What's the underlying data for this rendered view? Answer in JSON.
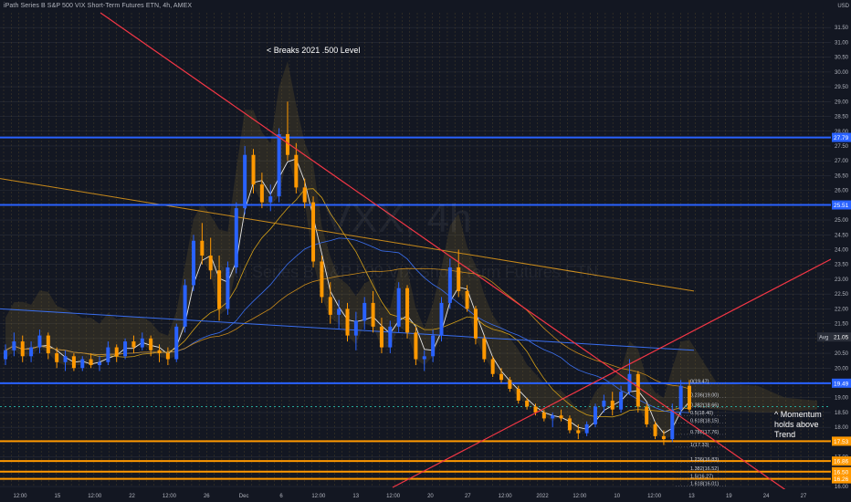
{
  "header": {
    "title": "iPath Series B S&P 500 VIX Short-Term Futures ETN, 4h, AMEX",
    "currency": "USD"
  },
  "watermark": {
    "symbol": "VXX, 4h",
    "name": "iPath Series B S&P 500 VIX Short-Term Futures ETN"
  },
  "annotations": {
    "breaks": "< Breaks 2021 .500 Level",
    "momentum": "^  Momentum\n    holds above\n    Trend"
  },
  "colors": {
    "background": "#131722",
    "grid": "#2a2e39",
    "vertical_grid": "#6b5a2e",
    "level_blue": "#2962ff",
    "level_orange": "#ff9800",
    "trend_red": "#f23645",
    "candle_up": "#2962ff",
    "candle_down": "#ff9800",
    "cloud": "#3a3a2a"
  },
  "chart_data": {
    "type": "candlestick",
    "title": "iPath Series B S&P 500 VIX Short-Term Futures ETN, 4h, AMEX",
    "y_axis": {
      "min": 16.0,
      "max": 32.0,
      "ticks": [
        "31.50",
        "31.00",
        "30.50",
        "30.00",
        "29.50",
        "29.00",
        "28.50",
        "28.00",
        "27.50",
        "27.00",
        "26.50",
        "26.00",
        "25.50",
        "25.00",
        "24.50",
        "24.00",
        "23.50",
        "23.00",
        "22.50",
        "22.00",
        "21.50",
        "21.00",
        "20.50",
        "20.00",
        "19.50",
        "19.00",
        "18.50",
        "18.00",
        "17.50",
        "17.00",
        "16.50",
        "16.00"
      ]
    },
    "x_axis": {
      "ticks": [
        "12:00",
        "15",
        "12:00",
        "22",
        "12:00",
        "26",
        "Dec",
        "6",
        "12:00",
        "13",
        "12:00",
        "20",
        "27",
        "12:00",
        "2022",
        "12:00",
        "10",
        "12:00",
        "13",
        "19",
        "24",
        "27"
      ]
    },
    "price_labels": [
      {
        "value": 27.79,
        "label": "27.79",
        "color": "#2962ff"
      },
      {
        "value": 25.51,
        "label": "25.51",
        "color": "#2962ff"
      },
      {
        "value": 21.05,
        "label": "21.05",
        "tag": "Avg",
        "color": "#2a2e39"
      },
      {
        "value": 19.49,
        "label": "19.49",
        "color": "#2962ff"
      },
      {
        "value": 17.53,
        "label": "17.53",
        "color": "#ff9800"
      },
      {
        "value": 16.86,
        "label": "16.86",
        "color": "#ff9800"
      },
      {
        "value": 16.5,
        "label": "16.50",
        "color": "#ff9800"
      },
      {
        "value": 16.26,
        "label": "16.26",
        "color": "#ff9800"
      }
    ],
    "horizontal_levels": [
      {
        "value": 27.79,
        "color": "blue"
      },
      {
        "value": 25.51,
        "color": "blue"
      },
      {
        "value": 19.49,
        "color": "blue"
      },
      {
        "value": 18.7,
        "color": "teal-dotted"
      },
      {
        "value": 17.53,
        "color": "orange"
      },
      {
        "value": 16.86,
        "color": "orange"
      },
      {
        "value": 16.5,
        "color": "orange"
      },
      {
        "value": 16.26,
        "color": "orange"
      }
    ],
    "fib_labels": [
      {
        "label": "0(19.47)",
        "value": 19.47
      },
      {
        "label": "0.236(19.00)",
        "value": 19.0
      },
      {
        "label": "0.382(18.66)",
        "value": 18.66
      },
      {
        "label": "0.5(18.40)",
        "value": 18.4
      },
      {
        "label": "0.618(18.15)",
        "value": 18.15
      },
      {
        "label": "0.786(17.76)",
        "value": 17.76
      },
      {
        "label": "1(17.33)",
        "value": 17.33
      },
      {
        "label": "1.236(16.83)",
        "value": 16.83
      },
      {
        "label": "1.382(16.52)",
        "value": 16.52
      },
      {
        "label": "1.5(16.27)",
        "value": 16.27
      },
      {
        "label": "1.618(16.01)",
        "value": 16.01
      }
    ],
    "candles": [
      [
        20.3,
        20.8,
        20.1,
        20.6
      ],
      [
        20.6,
        21.2,
        20.4,
        20.9
      ],
      [
        20.9,
        21.1,
        20.2,
        20.4
      ],
      [
        20.4,
        20.9,
        20.2,
        20.7
      ],
      [
        20.7,
        21.3,
        20.5,
        21.1
      ],
      [
        21.1,
        21.2,
        20.3,
        20.5
      ],
      [
        20.5,
        20.7,
        20.0,
        20.2
      ],
      [
        20.2,
        20.6,
        19.9,
        20.4
      ],
      [
        20.4,
        20.5,
        19.9,
        20.0
      ],
      [
        20.0,
        20.4,
        19.9,
        20.3
      ],
      [
        20.3,
        20.5,
        20.0,
        20.1
      ],
      [
        20.1,
        20.4,
        19.9,
        20.2
      ],
      [
        20.2,
        20.9,
        20.1,
        20.7
      ],
      [
        20.7,
        20.8,
        20.2,
        20.4
      ],
      [
        20.4,
        21.0,
        20.3,
        20.9
      ],
      [
        20.9,
        21.1,
        20.5,
        20.7
      ],
      [
        20.7,
        21.2,
        20.6,
        21.0
      ],
      [
        21.0,
        21.1,
        20.4,
        20.6
      ],
      [
        20.6,
        20.8,
        20.2,
        20.5
      ],
      [
        20.5,
        20.7,
        20.1,
        20.3
      ],
      [
        20.3,
        21.5,
        20.2,
        21.4
      ],
      [
        21.4,
        23.0,
        21.2,
        22.8
      ],
      [
        22.8,
        24.5,
        22.6,
        24.3
      ],
      [
        24.3,
        24.9,
        23.5,
        23.8
      ],
      [
        23.8,
        24.4,
        23.0,
        23.3
      ],
      [
        23.3,
        23.8,
        21.6,
        22.0
      ],
      [
        22.0,
        23.6,
        21.8,
        23.4
      ],
      [
        23.4,
        25.6,
        23.2,
        25.4
      ],
      [
        25.4,
        27.5,
        25.2,
        27.2
      ],
      [
        27.2,
        27.4,
        25.9,
        26.2
      ],
      [
        26.2,
        26.6,
        25.4,
        25.6
      ],
      [
        25.6,
        26.2,
        25.3,
        25.8
      ],
      [
        25.8,
        28.1,
        25.6,
        27.9
      ],
      [
        27.9,
        29.0,
        27.0,
        27.2
      ],
      [
        27.2,
        27.6,
        25.9,
        26.1
      ],
      [
        26.1,
        26.4,
        25.4,
        25.6
      ],
      [
        25.6,
        25.8,
        23.4,
        23.6
      ],
      [
        23.6,
        23.8,
        22.2,
        22.4
      ],
      [
        22.4,
        22.9,
        21.5,
        21.8
      ],
      [
        21.8,
        22.3,
        21.3,
        22.0
      ],
      [
        22.0,
        22.2,
        20.9,
        21.1
      ],
      [
        21.1,
        21.9,
        20.6,
        21.6
      ],
      [
        21.6,
        22.4,
        21.3,
        22.2
      ],
      [
        22.2,
        22.6,
        21.2,
        21.4
      ],
      [
        21.4,
        21.7,
        20.5,
        20.7
      ],
      [
        20.7,
        21.6,
        20.5,
        21.4
      ],
      [
        21.4,
        22.9,
        21.2,
        22.7
      ],
      [
        22.7,
        22.8,
        21.0,
        21.2
      ],
      [
        21.2,
        21.4,
        20.1,
        20.3
      ],
      [
        20.3,
        20.6,
        19.9,
        20.4
      ],
      [
        20.4,
        21.3,
        20.2,
        21.1
      ],
      [
        21.1,
        22.4,
        20.9,
        22.2
      ],
      [
        22.2,
        23.7,
        22.0,
        23.4
      ],
      [
        23.4,
        24.0,
        22.4,
        22.6
      ],
      [
        22.6,
        22.8,
        21.9,
        22.0
      ],
      [
        22.0,
        22.1,
        20.8,
        21.0
      ],
      [
        21.0,
        21.1,
        20.2,
        20.3
      ],
      [
        20.3,
        20.4,
        19.7,
        19.8
      ],
      [
        19.8,
        20.0,
        19.5,
        19.6
      ],
      [
        19.6,
        19.7,
        19.2,
        19.3
      ],
      [
        19.3,
        19.4,
        18.8,
        18.9
      ],
      [
        18.9,
        19.0,
        18.6,
        18.7
      ],
      [
        18.7,
        18.8,
        18.4,
        18.5
      ],
      [
        18.5,
        18.6,
        18.2,
        18.3
      ],
      [
        18.3,
        18.5,
        18.0,
        18.4
      ],
      [
        18.4,
        18.6,
        18.2,
        18.3
      ],
      [
        18.3,
        18.4,
        17.8,
        17.9
      ],
      [
        17.9,
        18.1,
        17.6,
        17.8
      ],
      [
        17.8,
        18.2,
        17.7,
        18.1
      ],
      [
        18.1,
        18.8,
        18.0,
        18.7
      ],
      [
        18.7,
        19.1,
        18.5,
        18.9
      ],
      [
        18.9,
        19.2,
        18.4,
        18.6
      ],
      [
        18.6,
        19.4,
        18.5,
        19.2
      ],
      [
        19.2,
        20.3,
        19.1,
        19.8
      ],
      [
        19.8,
        19.9,
        18.5,
        18.7
      ],
      [
        18.7,
        18.8,
        18.0,
        18.1
      ],
      [
        18.1,
        18.2,
        17.6,
        17.7
      ],
      [
        17.7,
        17.9,
        17.4,
        17.6
      ],
      [
        17.6,
        18.8,
        17.5,
        18.6
      ],
      [
        18.6,
        19.6,
        18.4,
        19.4
      ],
      [
        19.4,
        19.6,
        18.5,
        18.6
      ]
    ]
  }
}
